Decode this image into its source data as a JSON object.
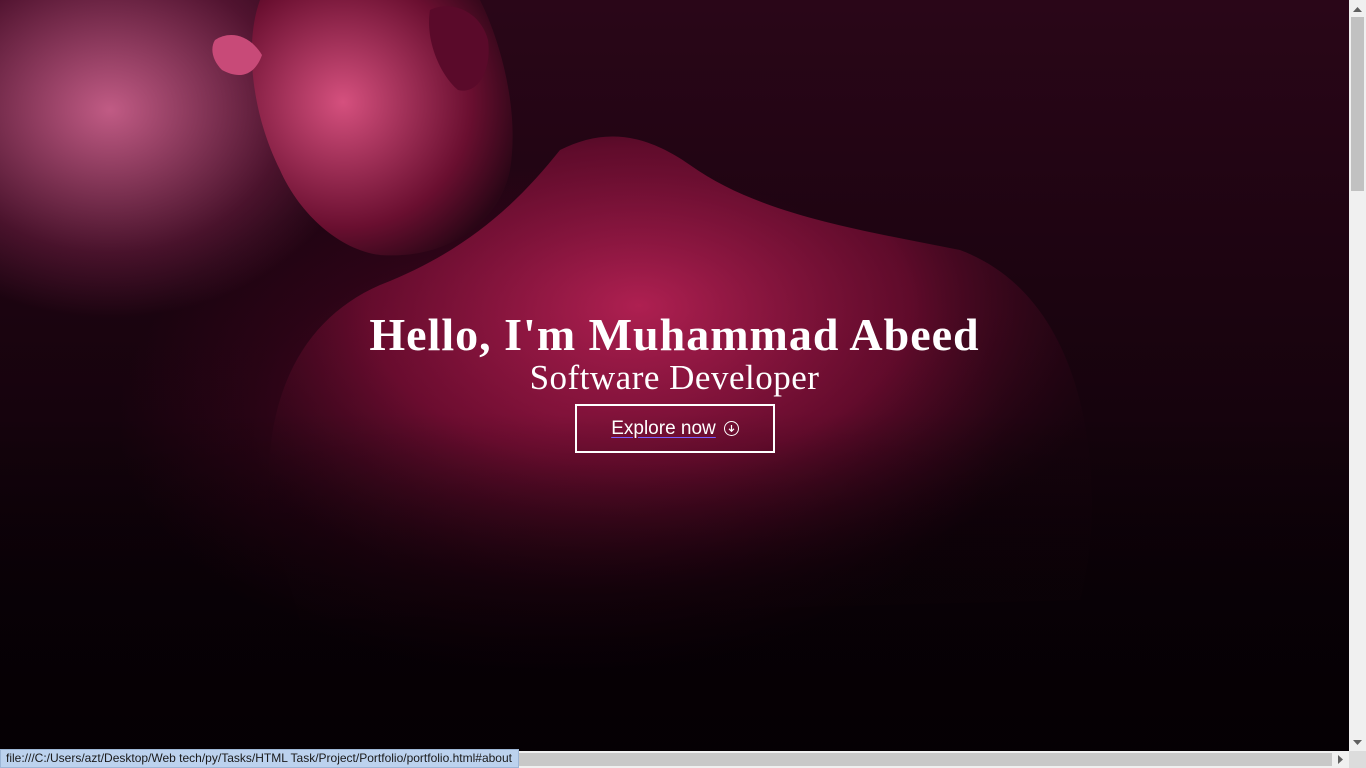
{
  "hero": {
    "title": "Hello, I'm Muhammad Abeed",
    "subtitle": "Software Developer",
    "cta_label": "Explore now",
    "cta_icon": "arrow-down-circle-icon"
  },
  "statusbar": {
    "url": "file:///C:/Users/azt/Desktop/Web tech/py/Tasks/HTML Task/Project/Portfolio/portfolio.html#about"
  },
  "colors": {
    "accent": "#c0144f",
    "text": "#ffffff",
    "link_underline": "#7b5cff"
  }
}
